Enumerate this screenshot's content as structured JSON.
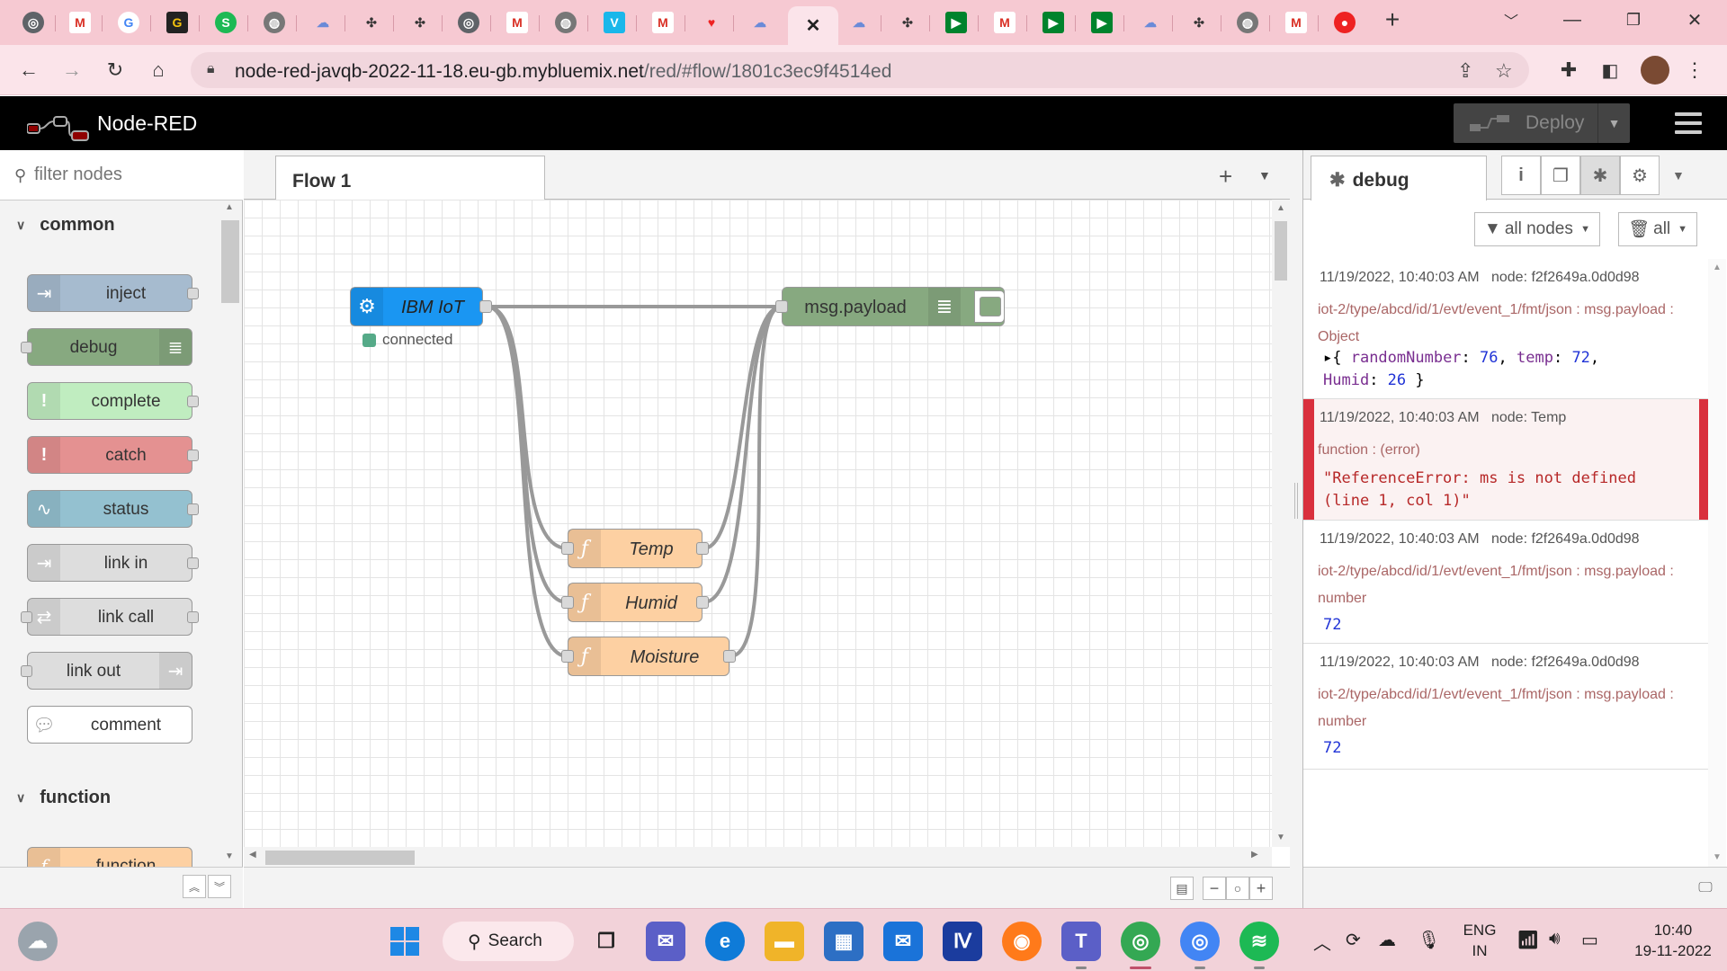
{
  "browser": {
    "tab_icons": [
      "chrome",
      "gmail",
      "google",
      "gdrive-g",
      "s-app",
      "globe",
      "cloud",
      "drone",
      "drone",
      "chrome",
      "gmail",
      "globe",
      "vimeo",
      "gmail",
      "heart",
      "cloud",
      "active-close",
      "cloud",
      "drone",
      "meet",
      "gmail",
      "meet",
      "meet",
      "cloud",
      "drone",
      "globe",
      "gmail",
      "record"
    ],
    "new_tab": "+",
    "url_host": "node-red-javqb-2022-11-18.eu-gb.mybluemix.net",
    "url_path": "/red/#flow/1801c3ec9f4514ed"
  },
  "header": {
    "title": "Node-RED",
    "deploy_label": "Deploy"
  },
  "palette": {
    "filter_placeholder": "filter nodes",
    "categories": [
      {
        "label": "common"
      },
      {
        "label": "function"
      }
    ],
    "nodes": [
      {
        "label": "inject",
        "color": "#a6bbcf"
      },
      {
        "label": "debug",
        "color": "#87a980"
      },
      {
        "label": "complete",
        "color": "#c0edc0"
      },
      {
        "label": "catch",
        "color": "#e49191"
      },
      {
        "label": "status",
        "color": "#94c1d0"
      },
      {
        "label": "link in",
        "color": "#dddddd"
      },
      {
        "label": "link call",
        "color": "#dddddd"
      },
      {
        "label": "link out",
        "color": "#dddddd"
      },
      {
        "label": "comment",
        "color": "#ffffff"
      },
      {
        "label": "function",
        "color": "#fdd0a2"
      }
    ]
  },
  "workspace": {
    "tab_label": "Flow 1",
    "nodes": [
      {
        "id": "ibmiot",
        "label": "IBM IoT",
        "color": "#1a96f2"
      },
      {
        "id": "msgpayload",
        "label": "msg.payload",
        "color": "#87a980"
      },
      {
        "id": "temp",
        "label": "Temp",
        "color": "#fdd0a2"
      },
      {
        "id": "humid",
        "label": "Humid",
        "color": "#fdd0a2"
      },
      {
        "id": "moisture",
        "label": "Moisture",
        "color": "#fdd0a2"
      }
    ],
    "status_text": "connected"
  },
  "sidebar": {
    "tab_label": "debug",
    "filter_nodes_label": "all nodes",
    "clear_label": "all",
    "messages": [
      {
        "timestamp": "11/19/2022, 10:40:03 AM",
        "node": "node: f2f2649a.0d0d98",
        "topic": "iot-2/type/abcd/id/1/evt/event_1/fmt/json : msg.payload : Object",
        "line1_prefix": "▸{ ",
        "k1": "randomNumber",
        "v1": "76",
        "k2": "temp",
        "v2": "72",
        "k3": "Humid",
        "v3": "26",
        "line_end": " }"
      },
      {
        "timestamp": "11/19/2022, 10:40:03 AM",
        "node": "node: Temp",
        "topic": "function : (error)",
        "value": "\"ReferenceError: ms is not defined (line 1, col 1)\""
      },
      {
        "timestamp": "11/19/2022, 10:40:03 AM",
        "node": "node: f2f2649a.0d0d98",
        "topic": "iot-2/type/abcd/id/1/evt/event_1/fmt/json : msg.payload : number",
        "value": "72"
      },
      {
        "timestamp": "11/19/2022, 10:40:03 AM",
        "node": "node: f2f2649a.0d0d98",
        "topic": "iot-2/type/abcd/id/1/evt/event_1/fmt/json : msg.payload : number",
        "value": "72"
      }
    ]
  },
  "taskbar": {
    "search_label": "Search",
    "lang_line1": "ENG",
    "lang_line2": "IN",
    "time": "10:40",
    "date": "19-11-2022"
  }
}
